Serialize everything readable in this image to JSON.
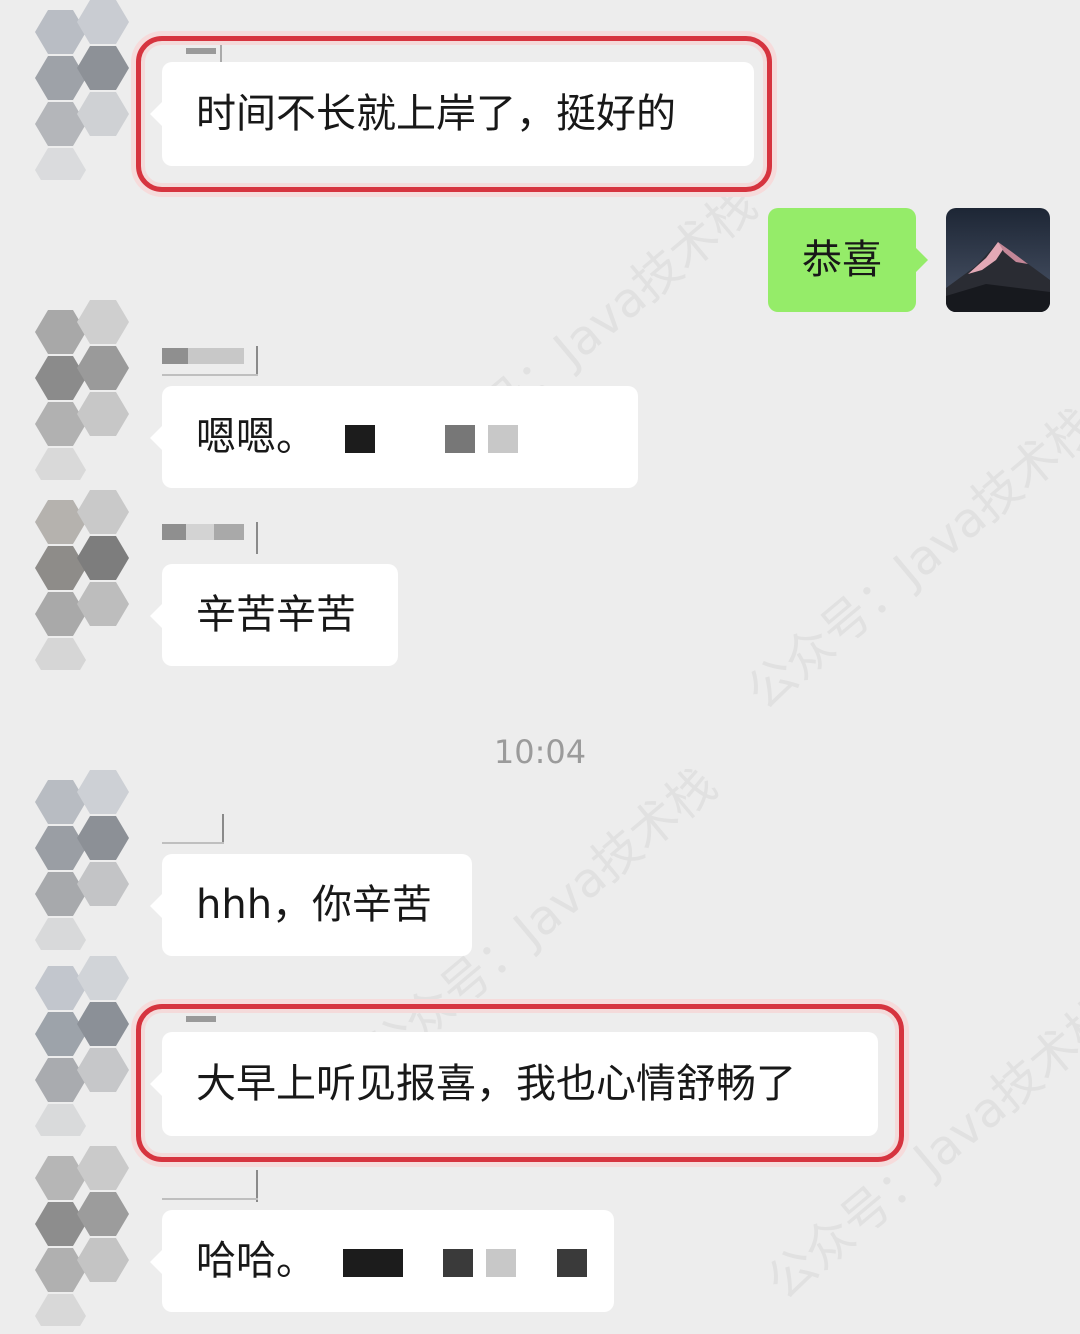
{
  "chat": {
    "messages": [
      {
        "side": "in",
        "text": "时间不长就上岸了，挺好的",
        "highlighted": true
      },
      {
        "side": "out",
        "text": "恭喜"
      },
      {
        "side": "in",
        "text": "嗯嗯。"
      },
      {
        "side": "in",
        "text": "辛苦辛苦"
      },
      {
        "side": "in",
        "text": "hhh，你辛苦"
      },
      {
        "side": "in",
        "text": "大早上听见报喜，我也心情舒畅了",
        "highlighted": true
      },
      {
        "side": "in",
        "text": "哈哈。"
      }
    ],
    "timestamp": "10:04"
  },
  "watermark": {
    "text": "公众号：Java技术栈"
  },
  "colors": {
    "background": "#ededed",
    "incoming_bubble": "#ffffff",
    "outgoing_bubble": "#95ec69",
    "highlight_frame": "#d6343f",
    "timestamp_text": "#9b9b9b"
  },
  "icons": {
    "my_avatar": "mountain-avatar-icon",
    "contact_avatar": "pixelated-avatar-icon"
  }
}
